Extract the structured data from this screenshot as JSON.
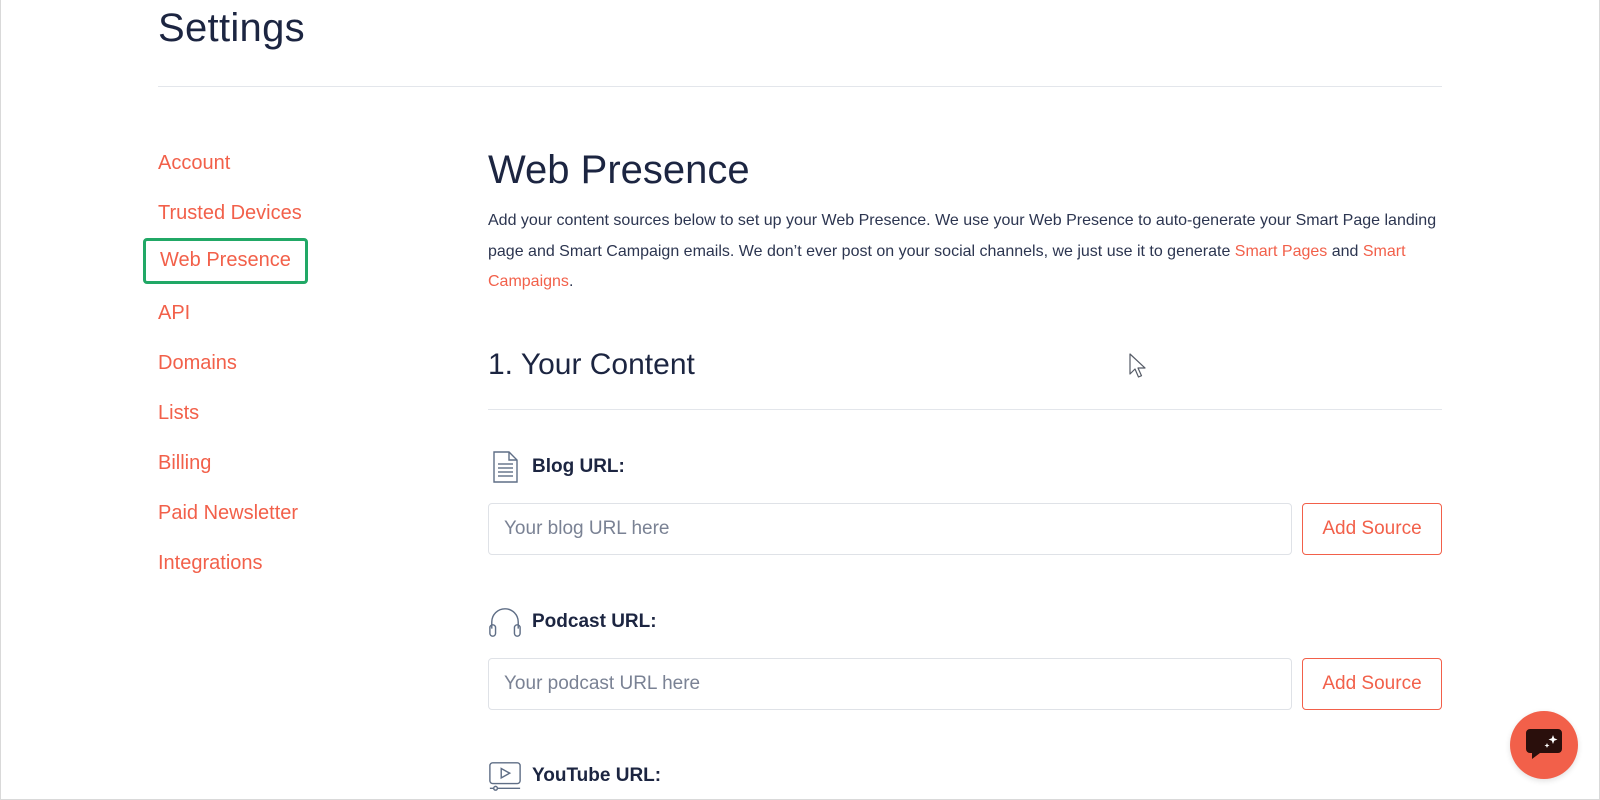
{
  "page": {
    "title": "Settings"
  },
  "sidebar": {
    "items": [
      {
        "label": "Account"
      },
      {
        "label": "Trusted Devices"
      },
      {
        "label": "Web Presence"
      },
      {
        "label": "API"
      },
      {
        "label": "Domains"
      },
      {
        "label": "Lists"
      },
      {
        "label": "Billing"
      },
      {
        "label": "Paid Newsletter"
      },
      {
        "label": "Integrations"
      }
    ],
    "active_item": "Web Presence"
  },
  "main": {
    "title": "Web Presence",
    "description": {
      "text_1": "Add your content sources below to set up your Web Presence. We use your Web Presence to auto-generate your Smart Page landing page and Smart Campaign emails. We don’t ever post on your social channels, we just use it to generate ",
      "link_1": "Smart Pages",
      "text_2": " and ",
      "link_2": "Smart Campaigns",
      "text_3": "."
    },
    "content_section": {
      "heading": "1. Your Content",
      "fields": [
        {
          "label": "Blog URL:",
          "placeholder": "Your blog URL here",
          "value": "",
          "button_label": "Add Source",
          "icon": "document-icon"
        },
        {
          "label": "Podcast URL:",
          "placeholder": "Your podcast URL here",
          "value": "",
          "button_label": "Add Source",
          "icon": "headphones-icon"
        },
        {
          "label": "YouTube URL:",
          "icon": "video-play-icon"
        }
      ]
    }
  },
  "colors": {
    "accent": "#f2604a",
    "active_outline": "#21a866",
    "heading": "#1c2541"
  },
  "chat_widget": {
    "icon": "chat-icon"
  }
}
